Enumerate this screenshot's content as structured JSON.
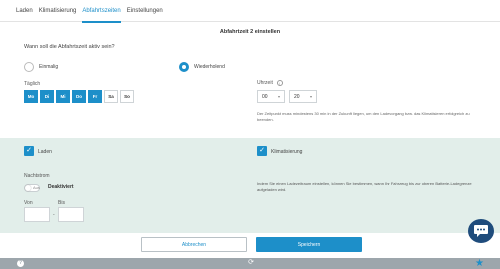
{
  "tabs": [
    {
      "label": "Laden",
      "active": false
    },
    {
      "label": "Klimatisierung",
      "active": false
    },
    {
      "label": "Abfahrtszeiten",
      "active": true
    },
    {
      "label": "Einstellungen",
      "active": false
    }
  ],
  "page": {
    "title": "Abfahrtzeit 2 einstellen"
  },
  "departure": {
    "question": "Wann soll die Abfahrtszeit aktiv sein?",
    "options": [
      {
        "label": "Einmalig",
        "selected": false
      },
      {
        "label": "Wiederholend",
        "selected": true
      }
    ],
    "days_label": "Täglich",
    "days": [
      {
        "label": "Mo",
        "on": true
      },
      {
        "label": "Di",
        "on": true
      },
      {
        "label": "Mi",
        "on": true
      },
      {
        "label": "Do",
        "on": true
      },
      {
        "label": "Fr",
        "on": true
      },
      {
        "label": "Sa",
        "on": false
      },
      {
        "label": "So",
        "on": false
      }
    ],
    "time_label": "Uhrzeit",
    "hour": "00",
    "minute": "20",
    "hint": "Der Zeitpunkt muss mindestens 30 min in der Zukunft liegen, um den Ladevorgang bzw. das Klimatisieren erfolgreich zu beenden."
  },
  "options_panel": {
    "laden_label": "Laden",
    "klima_label": "Klimatisierung",
    "nachtstrom_label": "Nachtstrom",
    "toggle_off": "Aus",
    "toggle_state": "Deaktiviert",
    "von_label": "Von",
    "bis_label": "Bis",
    "dash": "-",
    "laderaum_text": "Indem Sie einen Ladezeitraum einstellen, können Sie bestimmen, wann Ihr Fahrzeug bis zur oberen Batterie-Ladegrenze aufgeladen wird."
  },
  "actions": {
    "cancel_label": "Abbrechen",
    "save_label": "Speichern"
  },
  "footer": {
    "help_glyph": "?",
    "refresh_glyph": "⟳",
    "star_glyph": "★"
  },
  "colors": {
    "accent": "#1d8fc9",
    "panel": "#e2eeea",
    "chat": "#1f4c7c",
    "footer": "#9da6ac"
  }
}
